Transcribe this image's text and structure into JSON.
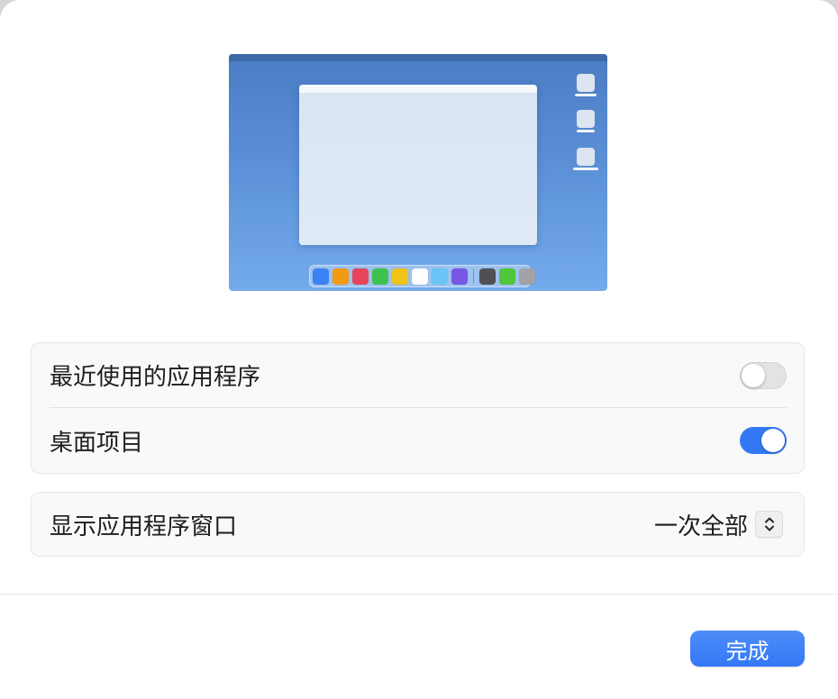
{
  "settings": {
    "recent_apps": {
      "label": "最近使用的应用程序",
      "enabled": false
    },
    "desktop_items": {
      "label": "桌面项目",
      "enabled": true
    },
    "show_app_windows": {
      "label": "显示应用程序窗口",
      "value": "一次全部"
    }
  },
  "done_button": {
    "label": "完成"
  },
  "preview": {
    "dock": {
      "apps": [
        "#3b82f6",
        "#f39a14",
        "#e5445a",
        "#3fc24d",
        "#f2c416",
        "#ffffff",
        "#6ac4f6",
        "#7757e4"
      ],
      "recent": [
        "#505054",
        "#50c73a",
        "#a2a2a7"
      ]
    }
  },
  "colors": {
    "accent": "#3478f6"
  }
}
